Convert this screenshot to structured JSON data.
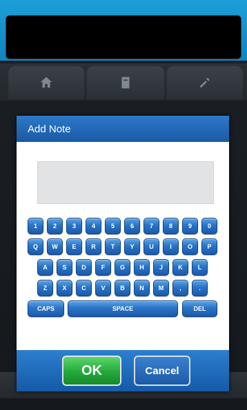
{
  "dialog": {
    "title": "Add Note",
    "note_value": "",
    "ok_label": "OK",
    "cancel_label": "Cancel"
  },
  "tabs": [
    {
      "icon": "home-icon"
    },
    {
      "icon": "document-icon"
    },
    {
      "icon": "tools-icon"
    }
  ],
  "keyboard": {
    "row1": [
      "1",
      "2",
      "3",
      "4",
      "5",
      "6",
      "7",
      "8",
      "9",
      "0"
    ],
    "row2": [
      "Q",
      "W",
      "E",
      "R",
      "T",
      "Y",
      "U",
      "I",
      "O",
      "P"
    ],
    "row3": [
      "A",
      "S",
      "D",
      "F",
      "G",
      "H",
      "J",
      "K",
      "L"
    ],
    "row4": [
      "Z",
      "X",
      "C",
      "V",
      "B",
      "N",
      "M",
      ",",
      "."
    ],
    "caps": "CAPS",
    "space": "SPACE",
    "del": "DEL"
  },
  "colors": {
    "accent": "#1d9ed7",
    "dialog_header": "#2c78c7",
    "ok_green": "#24a83a"
  }
}
